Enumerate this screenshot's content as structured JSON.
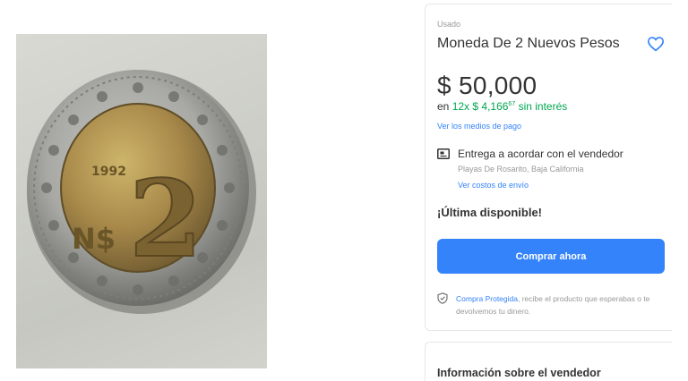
{
  "product": {
    "condition": "Usado",
    "title": "Moneda De 2 Nuevos Pesos",
    "price": "$ 50,000",
    "installments": {
      "prefix": "en",
      "offer": "12x $ 4,166",
      "cents": "67",
      "suffix": "sin interés"
    },
    "payment_methods_link": "Ver los medios de pago"
  },
  "delivery": {
    "text": "Entrega a acordar con el vendedor",
    "location": "Playas De Rosarito, Baja California",
    "shipping_link": "Ver costos de envío"
  },
  "stock": {
    "text": "¡Última disponible!"
  },
  "buy_button": {
    "label": "Comprar ahora"
  },
  "protection": {
    "link": "Compra Protegida",
    "text": ", recibe el producto que esperabas o te devolvemos tu dinero."
  },
  "seller": {
    "title": "Información sobre el vendedor"
  },
  "coin": {
    "year": "1992",
    "denomination": "2",
    "prefix": "N$"
  },
  "colors": {
    "accent": "#3483fa",
    "green": "#00a650"
  },
  "icons": {
    "heart": "heart-icon",
    "truck": "truck-icon",
    "shield": "shield-icon"
  }
}
